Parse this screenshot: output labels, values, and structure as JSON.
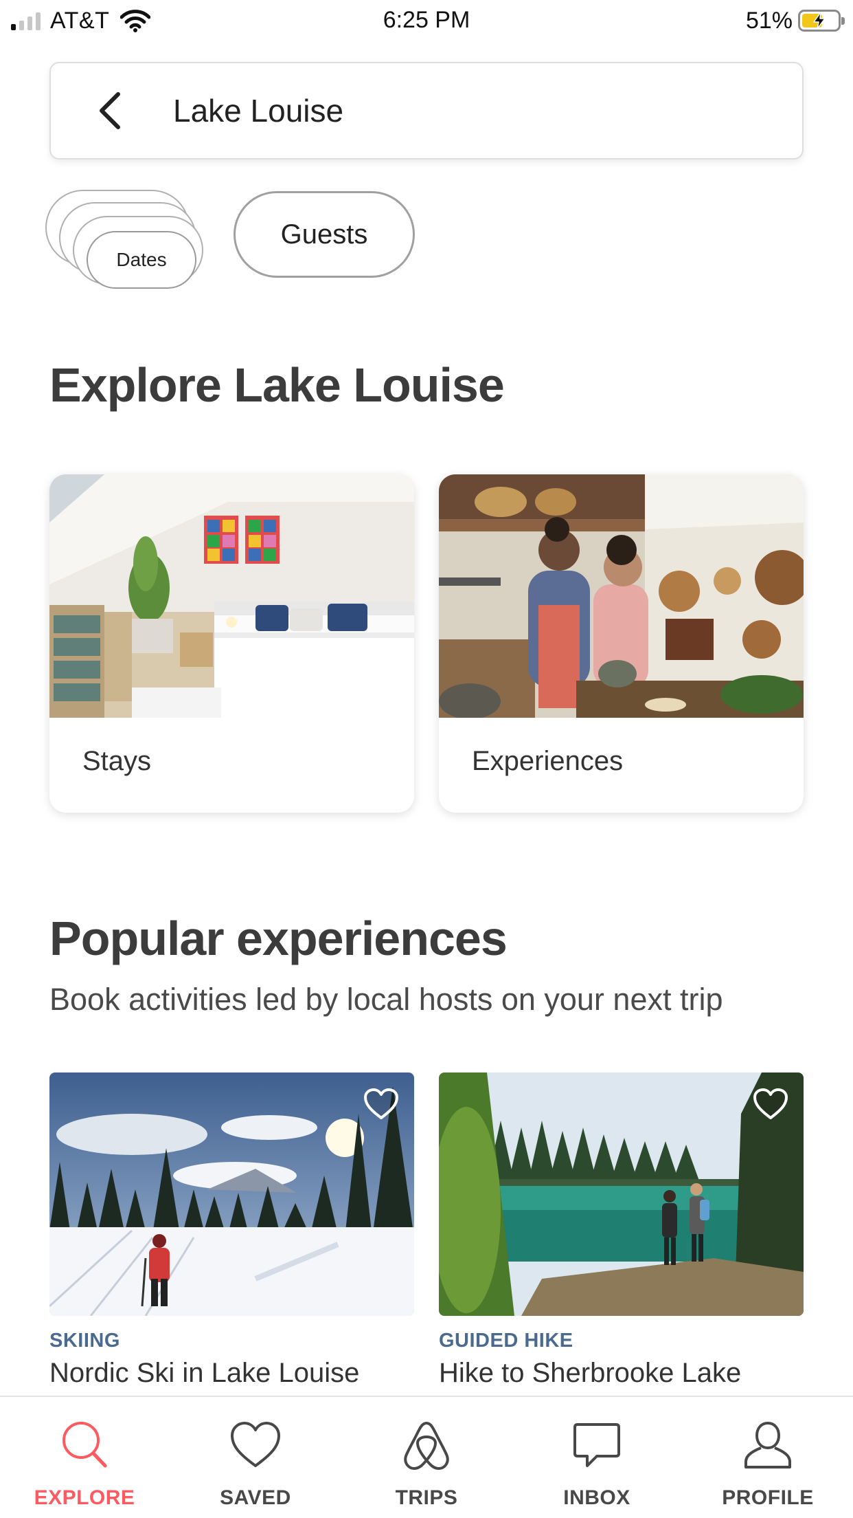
{
  "status_bar": {
    "carrier": "AT&T",
    "time": "6:25 PM",
    "battery_percent": "51%",
    "battery_level": 0.51,
    "signal_bars": 1
  },
  "search": {
    "query": "Lake Louise"
  },
  "filters": {
    "dates_label": "Dates",
    "guests_label": "Guests"
  },
  "explore_section": {
    "title": "Explore Lake Louise",
    "cards": [
      {
        "label": "Stays",
        "image": "bedroom-photo"
      },
      {
        "label": "Experiences",
        "image": "cooking-class-photo"
      }
    ]
  },
  "popular_section": {
    "title": "Popular experiences",
    "subtitle": "Book activities led by local hosts on your next trip",
    "items": [
      {
        "category": "SKIING",
        "title": "Nordic Ski in Lake Louise",
        "image": "snowy-forest-skier-photo",
        "saved": false
      },
      {
        "category": "GUIDED HIKE",
        "title": "Hike to Sherbrooke Lake",
        "image": "green-lake-hikers-photo",
        "saved": false
      }
    ]
  },
  "tab_bar": {
    "active": "explore",
    "tabs": [
      {
        "id": "explore",
        "label": "EXPLORE",
        "icon": "search-icon"
      },
      {
        "id": "saved",
        "label": "SAVED",
        "icon": "heart-icon"
      },
      {
        "id": "trips",
        "label": "TRIPS",
        "icon": "airbnb-logo-icon"
      },
      {
        "id": "inbox",
        "label": "INBOX",
        "icon": "chat-bubble-icon"
      },
      {
        "id": "profile",
        "label": "PROFILE",
        "icon": "person-icon"
      }
    ]
  },
  "colors": {
    "accent": "#ff5a5f",
    "category_text": "#4a6a8f",
    "heading": "#3c3c3c"
  }
}
